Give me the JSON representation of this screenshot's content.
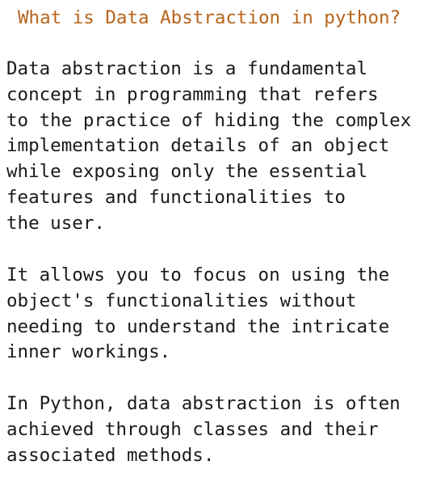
{
  "title": "What is Data Abstraction in python?",
  "paragraphs": [
    {
      "lines": [
        "Data abstraction is a fundamental",
        "concept in programming that refers",
        "to the practice of hiding the complex",
        "implementation details of an object",
        "while exposing only the essential",
        "features and functionalities to",
        "the user."
      ]
    },
    {
      "lines": [
        "It allows you to focus on using the",
        "object's functionalities without",
        "needing to understand the intricate",
        "inner workings."
      ]
    },
    {
      "lines": [
        "In Python, data abstraction is often",
        "achieved through classes and their",
        "associated methods."
      ]
    }
  ],
  "colors": {
    "title": "#b8651b",
    "text": "#1a1a1a",
    "background": "#ffffff"
  }
}
